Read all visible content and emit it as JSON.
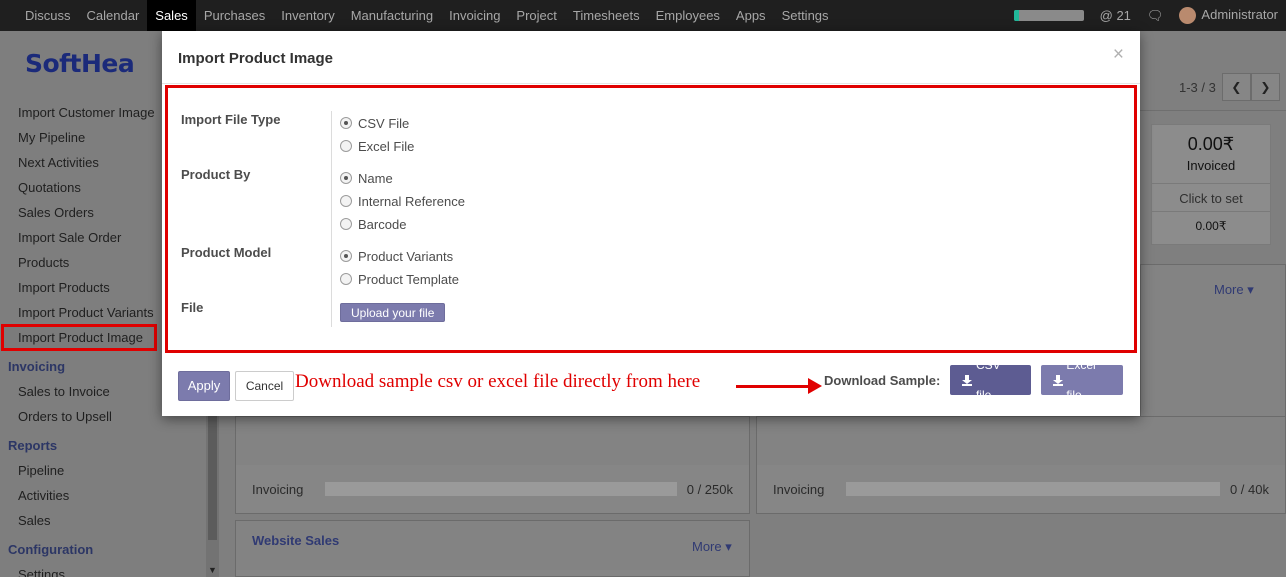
{
  "nav": {
    "items": [
      "Discuss",
      "Calendar",
      "Sales",
      "Purchases",
      "Inventory",
      "Manufacturing",
      "Invoicing",
      "Project",
      "Timesheets",
      "Employees",
      "Apps",
      "Settings"
    ],
    "active": "Sales",
    "progress": 0.08,
    "mention_count": "21",
    "user": "Administrator"
  },
  "sidebar": {
    "logo": "SoftHea",
    "items": [
      {
        "label": "Import Customer Image"
      },
      {
        "label": "My Pipeline"
      },
      {
        "label": "Next Activities"
      },
      {
        "label": "Quotations"
      },
      {
        "label": "Sales Orders"
      },
      {
        "label": "Import Sale Order"
      },
      {
        "label": "Products"
      },
      {
        "label": "Import Products"
      },
      {
        "label": "Import Product Variants"
      },
      {
        "label": "Import Product Image"
      }
    ],
    "invoicing_head": "Invoicing",
    "invoicing_items": [
      {
        "label": "Sales to Invoice"
      },
      {
        "label": "Orders to Upsell"
      }
    ],
    "reports_head": "Reports",
    "reports_items": [
      {
        "label": "Pipeline"
      },
      {
        "label": "Activities"
      },
      {
        "label": "Sales"
      }
    ],
    "config_head": "Configuration",
    "config_items": [
      {
        "label": "Settings"
      }
    ]
  },
  "dashboard": {
    "pager": "1-3 / 3",
    "invoiced_amount": "0.00₹",
    "invoiced_label": "Invoiced",
    "click_to_set": "Click to set",
    "invoiced_small": "0.00₹",
    "more": "More",
    "panel1_footer_label": "Invoicing",
    "panel1_footer_value": "0 / 250k",
    "panel2_footer_label": "Invoicing",
    "panel2_footer_value": "0 / 40k",
    "website_title": "Website Sales"
  },
  "modal": {
    "title": "Import Product Image",
    "close": "×",
    "fields": {
      "file_type_label": "Import File Type",
      "file_type_options": [
        "CSV File",
        "Excel File"
      ],
      "file_type_selected": "CSV File",
      "product_by_label": "Product By",
      "product_by_options": [
        "Name",
        "Internal Reference",
        "Barcode"
      ],
      "product_by_selected": "Name",
      "product_model_label": "Product Model",
      "product_model_options": [
        "Product Variants",
        "Product Template"
      ],
      "product_model_selected": "Product Variants",
      "file_label": "File",
      "upload_label": "Upload your file"
    },
    "footer": {
      "apply": "Apply",
      "cancel": "Cancel",
      "annotation": "Download sample csv or excel file directly from here",
      "download_label": "Download Sample:",
      "csv_btn": "CSV file",
      "excel_btn": "Excel file"
    }
  },
  "colors": {
    "accent": "#7c7bad",
    "highlight": "#e00000"
  }
}
